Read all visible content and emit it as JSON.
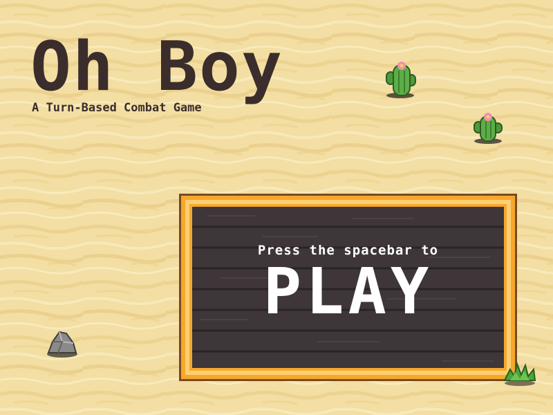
{
  "game": {
    "title": "Oh Boy",
    "subtitle": "A Turn-Based Combat Game"
  },
  "start_panel": {
    "prompt": "Press the spacebar to",
    "action": "PLAY"
  },
  "icons": {
    "cactus": "cactus-icon",
    "rock": "rock-icon",
    "bush": "desert-bush-icon"
  },
  "colors": {
    "sand": "#f2dc9c",
    "title_text": "#3a2d2b",
    "panel_wood": "#3e3638",
    "panel_frame": "#f4a830",
    "panel_text": "#ffffff"
  }
}
